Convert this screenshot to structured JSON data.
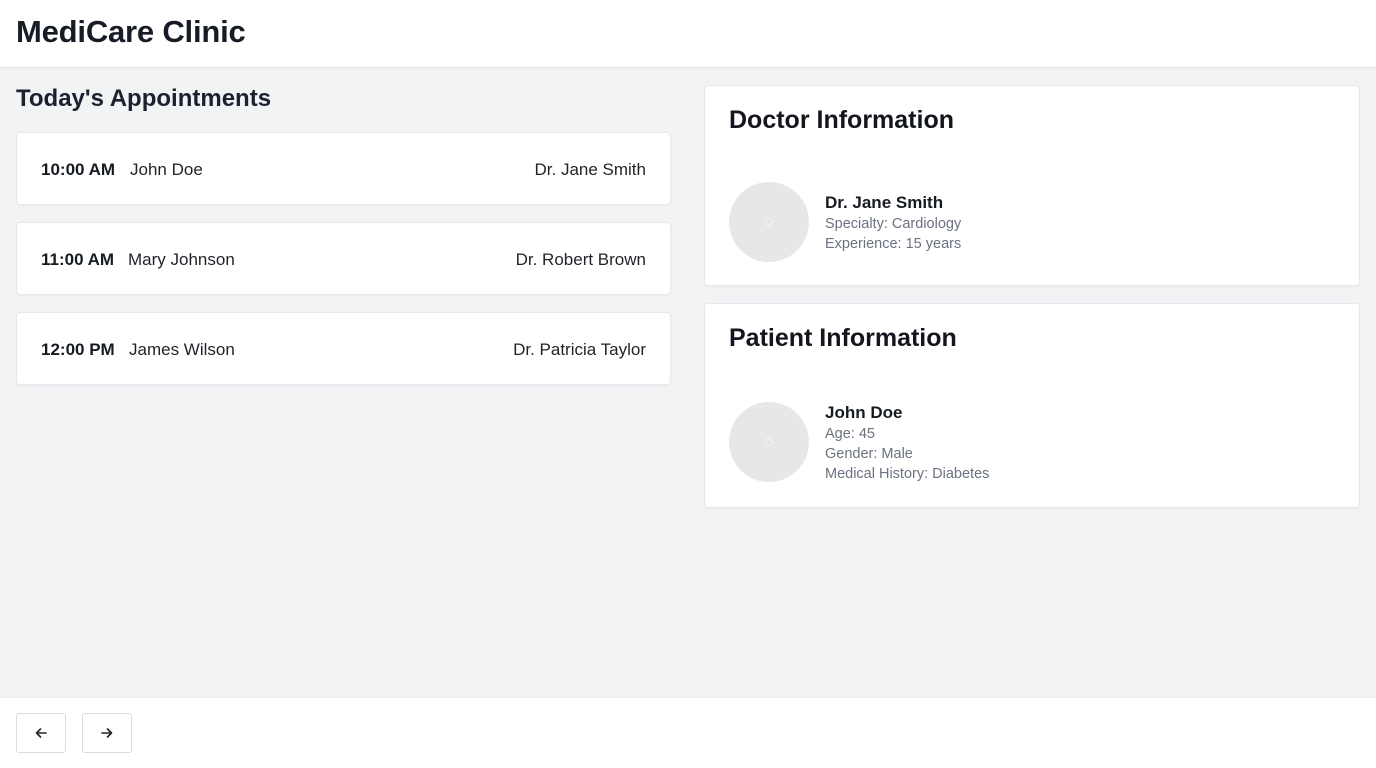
{
  "header": {
    "title": "MediCare Clinic"
  },
  "appointments": {
    "title": "Today's Appointments",
    "items": [
      {
        "time": "10:00 AM",
        "patient": "John Doe",
        "doctor": "Dr. Jane Smith"
      },
      {
        "time": "11:00 AM",
        "patient": "Mary Johnson",
        "doctor": "Dr. Robert Brown"
      },
      {
        "time": "12:00 PM",
        "patient": "James Wilson",
        "doctor": "Dr. Patricia Taylor"
      }
    ]
  },
  "doctor": {
    "title": "Doctor Information",
    "name": "Dr. Jane Smith",
    "specialty": "Specialty: Cardiology",
    "experience": "Experience: 15 years"
  },
  "patient": {
    "title": "Patient Information",
    "name": "John Doe",
    "age": "Age: 45",
    "gender": "Gender: Male",
    "history": "Medical History: Diabetes"
  },
  "footer": {
    "prev_icon": "arrow-left-icon",
    "next_icon": "arrow-right-icon"
  }
}
